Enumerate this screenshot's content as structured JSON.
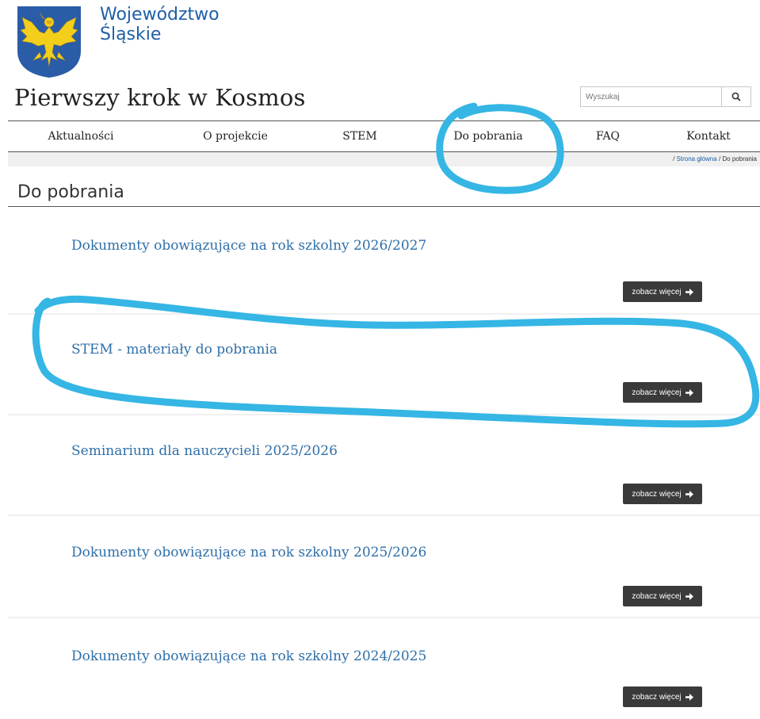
{
  "header": {
    "logo_line1": "Województwo",
    "logo_line2": "Śląskie",
    "site_title": "Pierwszy krok w Kosmos"
  },
  "search": {
    "placeholder": "Wyszukaj",
    "icon": "search-icon"
  },
  "nav": {
    "items": [
      {
        "label": "Aktualności"
      },
      {
        "label": "O projekcie"
      },
      {
        "label": "STEM"
      },
      {
        "label": "Do pobrania"
      },
      {
        "label": "FAQ"
      },
      {
        "label": "Kontakt"
      }
    ]
  },
  "breadcrumb": {
    "sep": "/",
    "home": "Strona główna",
    "current": "Do pobrania"
  },
  "page": {
    "title": "Do pobrania"
  },
  "items": [
    {
      "title": "Dokumenty obowiązujące na rok szkolny 2026/2027",
      "button": "zobacz więcej"
    },
    {
      "title": "STEM - materiały do pobrania",
      "button": "zobacz więcej"
    },
    {
      "title": "Seminarium dla nauczycieli 2025/2026",
      "button": "zobacz więcej"
    },
    {
      "title": "Dokumenty obowiązujące na rok szkolny 2025/2026",
      "button": "zobacz więcej"
    },
    {
      "title": "Dokumenty obowiązujące na rok szkolny 2024/2025",
      "button": "zobacz więcej"
    }
  ],
  "colors": {
    "annotation": "#35b6e4",
    "link": "#2f6fa8",
    "button": "#3a3a3a"
  }
}
